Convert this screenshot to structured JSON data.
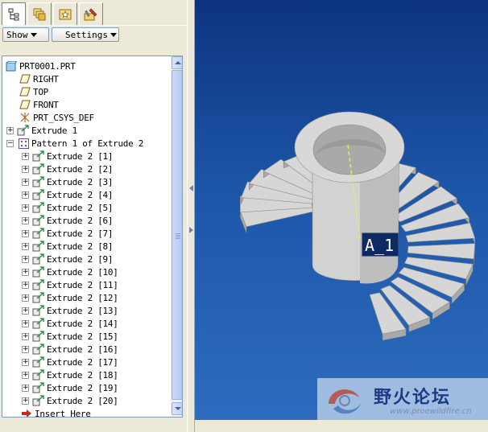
{
  "tabs": [
    {
      "name": "model-tree-tab",
      "icon": "model-tree-icon"
    },
    {
      "name": "layers-tab",
      "icon": "layers-icon"
    },
    {
      "name": "folder-tab",
      "icon": "favorites-icon"
    },
    {
      "name": "tools-tab",
      "icon": "tools-icon"
    }
  ],
  "toolbar": {
    "show_label": "Show",
    "settings_label": "Settings"
  },
  "tree": {
    "root": "PRT0001.PRT",
    "datums": [
      "RIGHT",
      "TOP",
      "FRONT"
    ],
    "csys": "PRT_CSYS_DEF",
    "extrude1": "Extrude 1",
    "pattern": "Pattern 1 of Extrude 2",
    "members": [
      "Extrude 2 [1]",
      "Extrude 2 [2]",
      "Extrude 2 [3]",
      "Extrude 2 [4]",
      "Extrude 2 [5]",
      "Extrude 2 [6]",
      "Extrude 2 [7]",
      "Extrude 2 [8]",
      "Extrude 2 [9]",
      "Extrude 2 [10]",
      "Extrude 2 [11]",
      "Extrude 2 [12]",
      "Extrude 2 [13]",
      "Extrude 2 [14]",
      "Extrude 2 [15]",
      "Extrude 2 [16]",
      "Extrude 2 [17]",
      "Extrude 2 [18]",
      "Extrude 2 [19]",
      "Extrude 2 [20]"
    ],
    "insert_here": "Insert Here"
  },
  "viewport": {
    "axis_label": "A_1",
    "background_top": "#0d3380",
    "background_bottom": "#2d6cbe"
  },
  "watermark": {
    "title": "野火论坛",
    "url": "www.proewildfire.cn"
  }
}
